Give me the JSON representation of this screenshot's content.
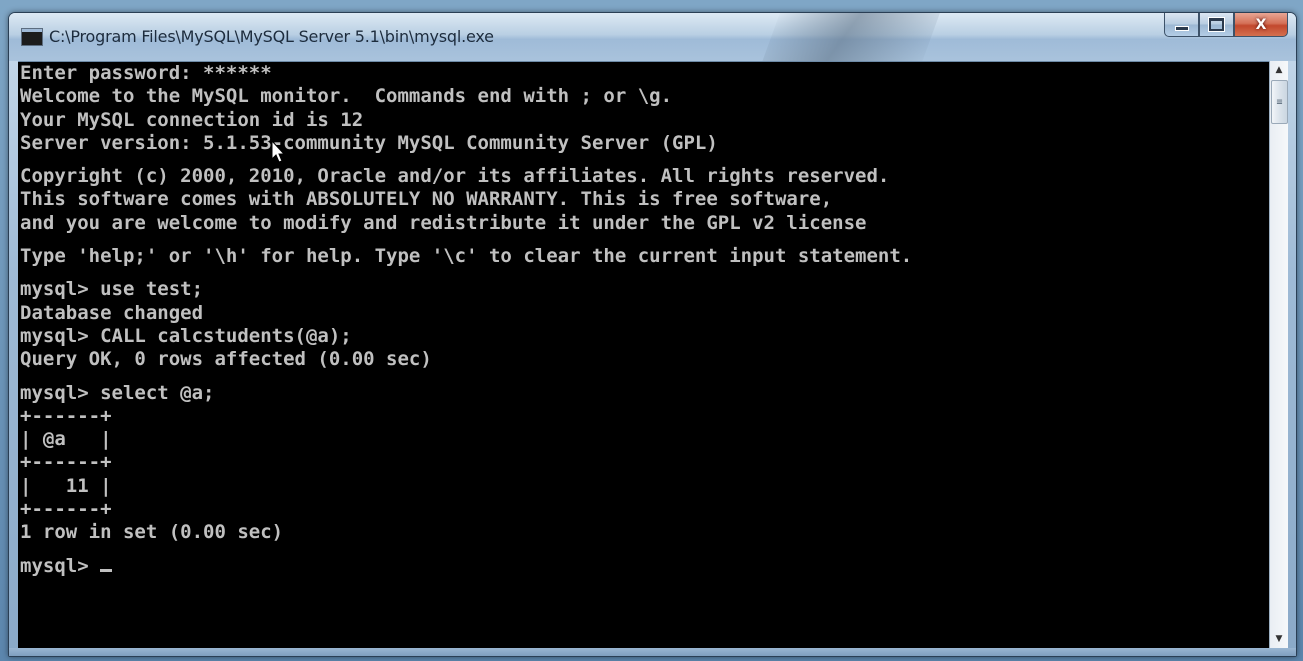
{
  "window": {
    "title": "C:\\Program Files\\MySQL\\MySQL Server 5.1\\bin\\mysql.exe",
    "close_glyph": "X"
  },
  "console": {
    "lines": [
      "Enter password: ******",
      "Welcome to the MySQL monitor.  Commands end with ; or \\g.",
      "Your MySQL connection id is 12",
      "Server version: 5.1.53-community MySQL Community Server (GPL)",
      "",
      "Copyright (c) 2000, 2010, Oracle and/or its affiliates. All rights reserved.",
      "This software comes with ABSOLUTELY NO WARRANTY. This is free software,",
      "and you are welcome to modify and redistribute it under the GPL v2 license",
      "",
      "Type 'help;' or '\\h' for help. Type '\\c' to clear the current input statement.",
      "",
      "mysql> use test;",
      "Database changed",
      "mysql> CALL calcstudents(@a);",
      "Query OK, 0 rows affected (0.00 sec)",
      "",
      "mysql> select @a;",
      "+------+",
      "| @a   |",
      "+------+",
      "|   11 |",
      "+------+",
      "1 row in set (0.00 sec)",
      "",
      "mysql> "
    ]
  },
  "scrollbar": {
    "up_glyph": "▲",
    "down_glyph": "▼",
    "thumb_glyph": "≡"
  },
  "icons": [
    "console-app-icon",
    "minimize-icon",
    "maximize-icon",
    "close-icon",
    "mouse-pointer-icon"
  ],
  "colors": {
    "console_bg": "#000000",
    "console_text": "#c0c0c0",
    "close_button": "#c84a30"
  }
}
